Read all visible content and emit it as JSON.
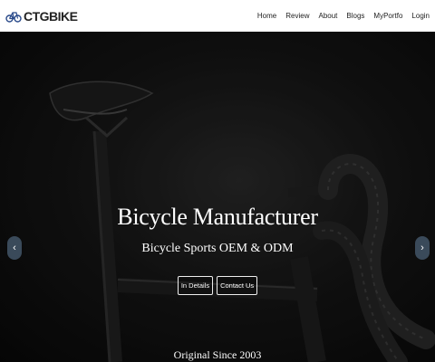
{
  "header": {
    "brand": "CTGBIKE",
    "nav": [
      "Home",
      "Review",
      "About",
      "Blogs",
      "MyPortfo",
      "Login"
    ]
  },
  "hero": {
    "title": "Bicycle Manufacturer",
    "subtitle": "Bicycle Sports OEM & ODM",
    "details_button": "In Details",
    "contact_button": "Contact Us",
    "since": "Original Since 2003",
    "prev_icon": "chevron-left-icon",
    "next_icon": "chevron-right-icon"
  },
  "colors": {
    "navbar_bg": "#ffffff",
    "hero_bg": "#0a0a0a",
    "arrow_bg": "#3a4a5a"
  }
}
